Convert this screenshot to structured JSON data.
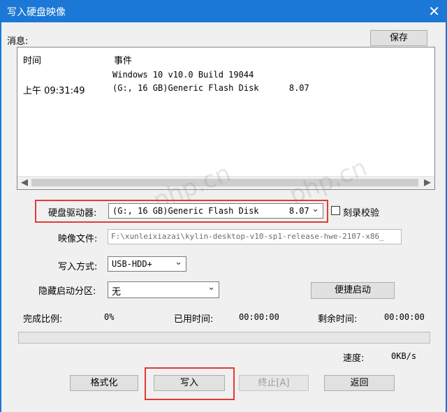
{
  "window": {
    "title": "写入硬盘映像",
    "close_glyph": "✕"
  },
  "messages": {
    "label": "消息:",
    "save_button": "保存",
    "col_time": "时间",
    "col_event": "事件",
    "rows": [
      {
        "time": "",
        "event": "Windows 10 v10.0 Build 19044"
      },
      {
        "time": "上午 09:31:49",
        "event": "(G:, 16 GB)Generic Flash Disk      8.07"
      }
    ]
  },
  "drive": {
    "label": "硬盘驱动器:",
    "value": "(G:, 16 GB)Generic Flash Disk      8.07",
    "verify_label": "刻录校验",
    "verify_checked": false
  },
  "image_file": {
    "label": "映像文件:",
    "value": "F:\\xunleixiazai\\kylin-desktop-v10-sp1-release-hwe-2107-x86_"
  },
  "write_mode": {
    "label": "写入方式:",
    "value": "USB-HDD+"
  },
  "hidden_partition": {
    "label": "隐藏启动分区:",
    "value": "无"
  },
  "quick_boot_button": "便捷启动",
  "status": {
    "done_label": "完成比例:",
    "done_value": "0%",
    "elapsed_label": "已用时间:",
    "elapsed_value": "00:00:00",
    "remaining_label": "剩余时间:",
    "remaining_value": "00:00:00",
    "speed_label": "速度:",
    "speed_value": "0KB/s",
    "progress_fraction": 0
  },
  "buttons": {
    "format": "格式化",
    "write": "写入",
    "abort": "终止[A]",
    "back": "返回"
  },
  "watermark": "php.cn",
  "colors": {
    "titlebar": "#1b78d6",
    "highlight": "#e53935",
    "progress": "#06b025"
  }
}
